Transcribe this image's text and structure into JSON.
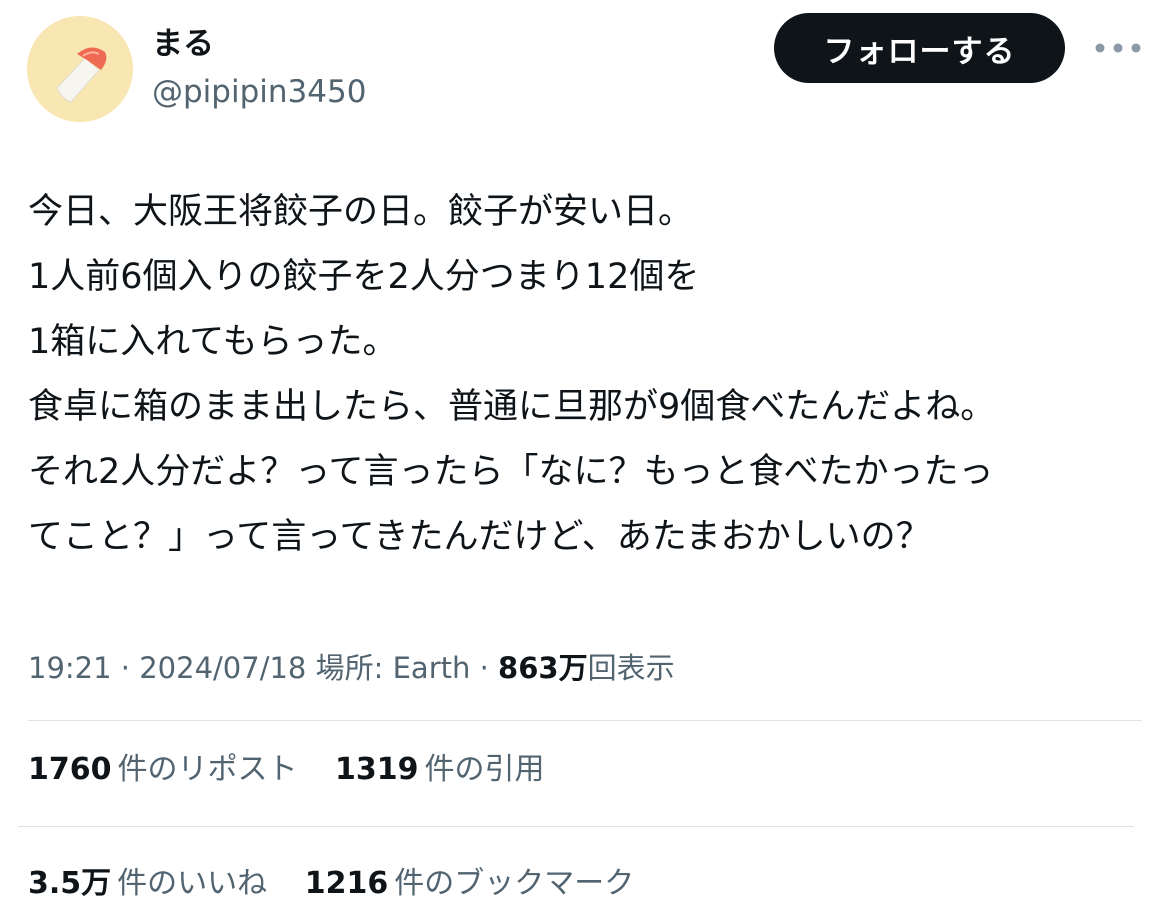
{
  "user": {
    "display_name": "まる",
    "handle": "@pipipin3450",
    "avatar_icon": "avatar-image"
  },
  "actions": {
    "follow_label": "フォローする",
    "more_icon": "more-dots-icon"
  },
  "tweet": {
    "lines": [
      "今日、大阪王将餃子の日。餃子が安い日。",
      "1人前6個入りの餃子を2人分つまり12個を",
      "1箱に入れてもらった。",
      "食卓に箱のまま出したら、普通に旦那が9個食べたんだよね。",
      "それ2人分だよ？って言ったら「なに？もっと食べたかったっ",
      "てこと？」って言ってきたんだけど、あたまおかしいの？"
    ]
  },
  "meta": {
    "time": "19:21",
    "sep1": " · ",
    "date": "2024/07/18",
    "location": "場所: Earth",
    "sep2": " · ",
    "views_number": "863万",
    "views_label": "回表示"
  },
  "stats": {
    "reposts_count": "1760",
    "reposts_label": "件のリポスト",
    "quotes_count": "1319",
    "quotes_label": "件の引用",
    "likes_count": "3.5万",
    "likes_label": "件のいいね",
    "bookmarks_count": "1216",
    "bookmarks_label": "件のブックマーク"
  },
  "colors": {
    "text_primary": "#0f1419",
    "text_secondary": "#536471",
    "follow_bg": "#0f1419",
    "divider": "#dfe3e6",
    "avatar_bg": "#f8e7b3"
  }
}
